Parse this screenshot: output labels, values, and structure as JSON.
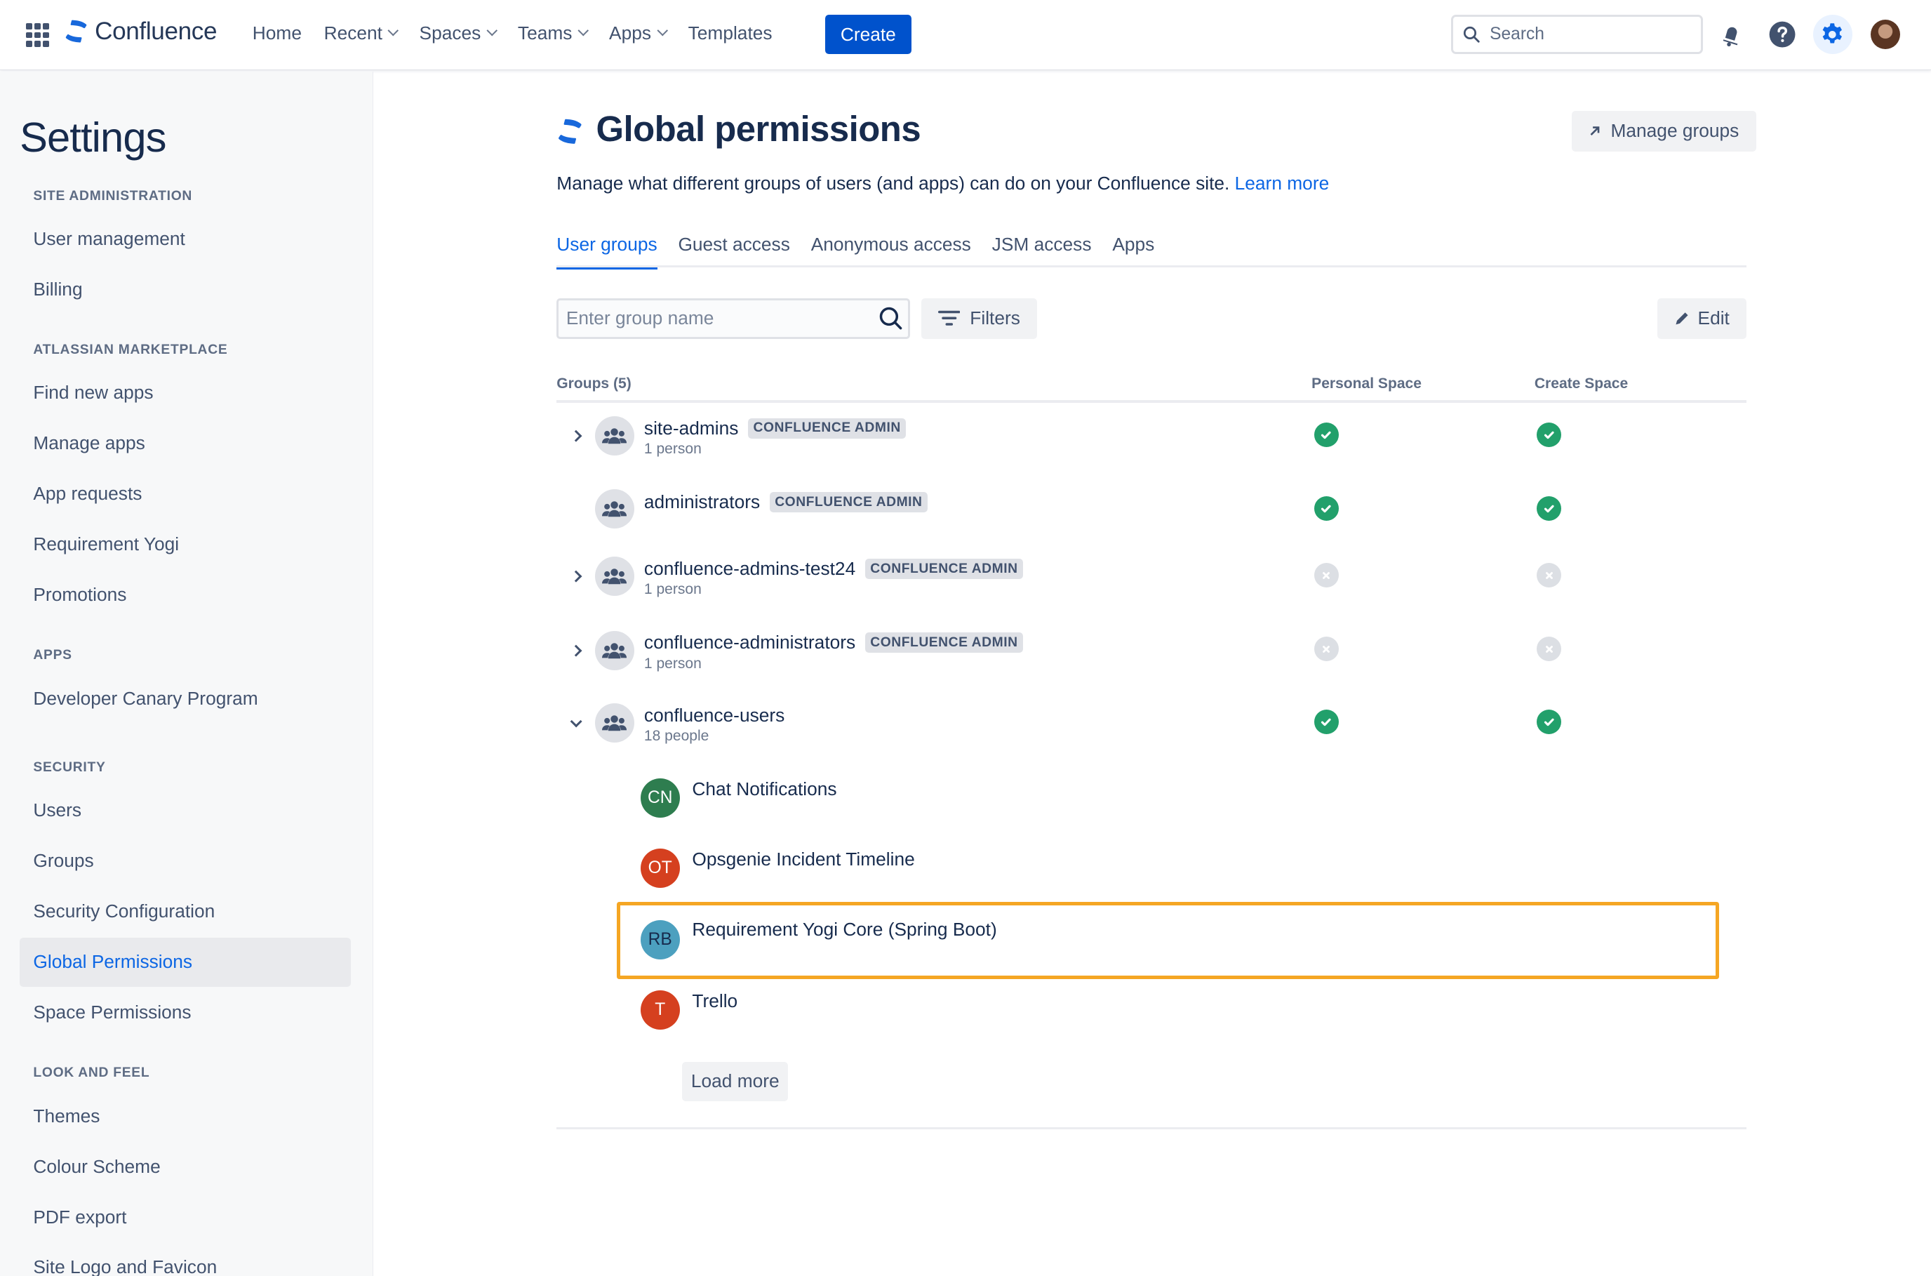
{
  "topnav": {
    "product_name": "Confluence",
    "items": [
      {
        "label": "Home",
        "has_dropdown": false
      },
      {
        "label": "Recent",
        "has_dropdown": true
      },
      {
        "label": "Spaces",
        "has_dropdown": true
      },
      {
        "label": "Teams",
        "has_dropdown": true
      },
      {
        "label": "Apps",
        "has_dropdown": true
      },
      {
        "label": "Templates",
        "has_dropdown": false
      }
    ],
    "create_label": "Create",
    "search_placeholder": "Search",
    "icons": [
      "app-switcher-icon",
      "notifications-icon",
      "help-icon",
      "settings-icon",
      "profile-avatar"
    ],
    "accent_color": "#0052CC"
  },
  "sidebar": {
    "title": "Settings",
    "sections": [
      {
        "heading": "SITE ADMINISTRATION",
        "items": [
          "User management",
          "Billing"
        ]
      },
      {
        "heading": "ATLASSIAN MARKETPLACE",
        "items": [
          "Find new apps",
          "Manage apps",
          "App requests",
          "Requirement Yogi",
          "Promotions"
        ]
      },
      {
        "heading": "APPS",
        "items": [
          "Developer Canary Program"
        ]
      },
      {
        "heading": "SECURITY",
        "items": [
          "Users",
          "Groups",
          "Security Configuration",
          "Global Permissions",
          "Space Permissions"
        ]
      },
      {
        "heading": "LOOK AND FEEL",
        "items": [
          "Themes",
          "Colour Scheme",
          "PDF export",
          "Site Logo and Favicon"
        ]
      }
    ],
    "active_item": "Global Permissions"
  },
  "main": {
    "title": "Global permissions",
    "manage_groups_label": "Manage groups",
    "description": "Manage what different groups of users (and apps) can do on your Confluence site.",
    "learn_more_label": "Learn more",
    "tabs": [
      {
        "label": "User groups",
        "active": true
      },
      {
        "label": "Guest access",
        "active": false
      },
      {
        "label": "Anonymous access",
        "active": false
      },
      {
        "label": "JSM access",
        "active": false
      },
      {
        "label": "Apps",
        "active": false
      }
    ],
    "group_search_placeholder": "Enter group name",
    "filters_label": "Filters",
    "edit_label": "Edit",
    "table": {
      "headers": {
        "groups": "Groups (5)",
        "personal_space": "Personal Space",
        "create_space": "Create Space"
      },
      "rows": [
        {
          "name": "site-admins",
          "badge": "CONFLUENCE ADMIN",
          "sub": "1 person",
          "expander": "collapsed",
          "personal_space": true,
          "create_space": true
        },
        {
          "name": "administrators",
          "badge": "CONFLUENCE ADMIN",
          "sub": "",
          "expander": "none",
          "personal_space": true,
          "create_space": true
        },
        {
          "name": "confluence-admins-test24",
          "badge": "CONFLUENCE ADMIN",
          "sub": "1 person",
          "expander": "collapsed",
          "personal_space": false,
          "create_space": false
        },
        {
          "name": "confluence-administrators",
          "badge": "CONFLUENCE ADMIN",
          "sub": "1 person",
          "expander": "collapsed",
          "personal_space": false,
          "create_space": false
        },
        {
          "name": "confluence-users",
          "badge": "",
          "sub": "18 people",
          "expander": "expanded",
          "personal_space": true,
          "create_space": true
        }
      ],
      "members": [
        {
          "initials": "CN",
          "name": "Chat Notifications",
          "color": "#2E7D4F",
          "highlighted": false
        },
        {
          "initials": "OT",
          "name": "Opsgenie Incident Timeline",
          "color": "#D5401F",
          "highlighted": false
        },
        {
          "initials": "RB",
          "name": "Requirement Yogi Core (Spring Boot)",
          "color": "#4CA0BF",
          "highlighted": true
        },
        {
          "initials": "T",
          "name": "Trello",
          "color": "#D5401F",
          "highlighted": false
        }
      ],
      "load_more_label": "Load more"
    },
    "status_colors": {
      "granted": "#22A06B",
      "denied": "#DCDFE4",
      "highlight": "#F5A623"
    }
  }
}
